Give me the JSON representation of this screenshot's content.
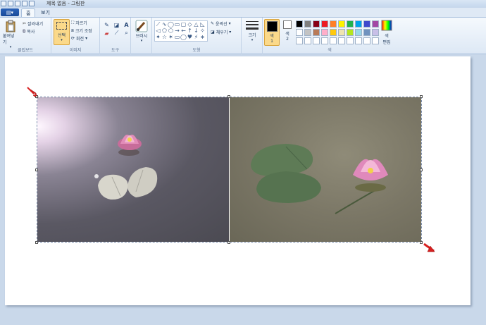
{
  "window": {
    "title": "제목 없음 - 그림판"
  },
  "tabs": {
    "file": "",
    "home": "홈",
    "view": "보기"
  },
  "ribbon": {
    "clipboard": {
      "label": "클립보드",
      "paste": "붙여넣기",
      "cut": "잘라내기",
      "copy": "복사"
    },
    "image": {
      "label": "이미지",
      "select": "선택",
      "crop": "자르기",
      "resize": "크기 조정",
      "rotate": "회전"
    },
    "tools": {
      "label": "도구"
    },
    "brushes": {
      "label": "브러시"
    },
    "shapes": {
      "label": "도형",
      "outline": "윤곽선",
      "fill": "채우기"
    },
    "size": {
      "label": "크기"
    },
    "colors": {
      "label": "색",
      "color1": "색\n1",
      "color2": "색\n2",
      "edit": "색\n편집",
      "palette_row1": [
        "#000000",
        "#7f7f7f",
        "#880015",
        "#ed1c24",
        "#ff7f27",
        "#fff200",
        "#22b14c",
        "#00a2e8",
        "#3f48cc",
        "#a349a4"
      ],
      "palette_row2": [
        "#ffffff",
        "#c3c3c3",
        "#b97a57",
        "#ffaec9",
        "#ffc90e",
        "#efe4b0",
        "#b5e61d",
        "#99d9ea",
        "#7092be",
        "#c8bfe7"
      ],
      "palette_row3": [
        "#ffffff",
        "#ffffff",
        "#ffffff",
        "#ffffff",
        "#ffffff",
        "#ffffff",
        "#ffffff",
        "#ffffff",
        "#ffffff",
        "#ffffff"
      ]
    }
  },
  "icons": {
    "shapes": [
      "⟋",
      "∿",
      "◯",
      "▭",
      "▢",
      "◇",
      "△",
      "◺",
      "◁",
      "⬠",
      "⬡",
      "→",
      "←",
      "↑",
      "↓",
      "✧",
      "✦",
      "☆",
      "✶",
      "▭",
      "◯",
      "♥",
      "⚡",
      "∗"
    ]
  },
  "canvas": {
    "background": "#ffffff"
  }
}
